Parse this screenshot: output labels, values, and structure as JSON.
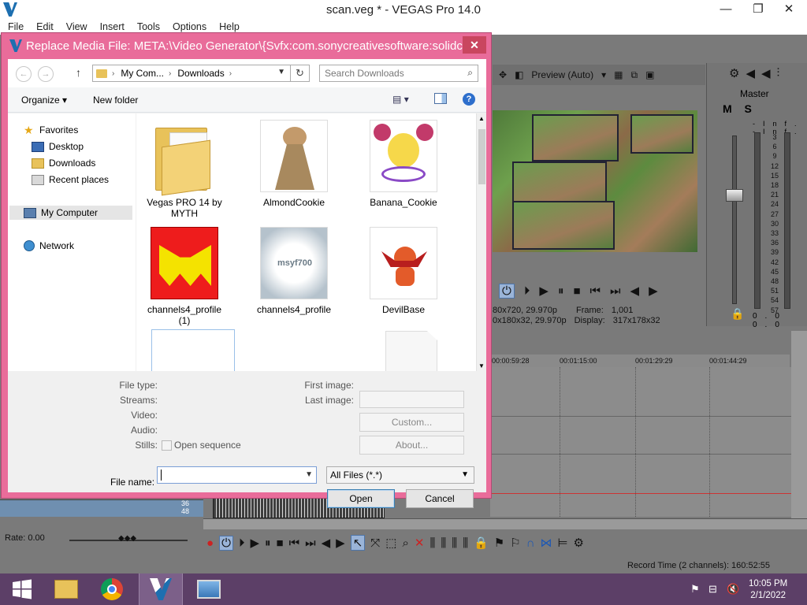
{
  "app": {
    "title": "scan.veg * - VEGAS Pro 14.0",
    "controls": {
      "minimize": "—",
      "restore": "❐",
      "close": "✕"
    },
    "menu": [
      "File",
      "Edit",
      "View",
      "Insert",
      "Tools",
      "Options",
      "Help"
    ]
  },
  "preview": {
    "mode": "Preview (Auto)",
    "info_left_1": "80x720, 29.970p",
    "info_left_2": "0x180x32, 29.970p",
    "frame_label": "Frame:",
    "frame_value": "1,001",
    "display_label": "Display:",
    "display_value": "317x178x32"
  },
  "master": {
    "label": "Master",
    "mute_solo": "M S",
    "inf_top": "-Inf. -Inf.",
    "scale": [
      "3",
      "6",
      "9",
      "12",
      "15",
      "18",
      "21",
      "24",
      "27",
      "30",
      "33",
      "36",
      "39",
      "42",
      "45",
      "48",
      "51",
      "54",
      "57"
    ],
    "foot": "0.0 0.0"
  },
  "timeline": {
    "ruler": [
      "00:00:59:28",
      "00:01:15:00",
      "00:01:29:29",
      "00:01:44:29"
    ],
    "track_nums": [
      "36",
      "48"
    ]
  },
  "bottom": {
    "rate": "Rate: 0.00",
    "record_time": "Record Time (2 channels): 160:52:55"
  },
  "dialog": {
    "title": "Replace Media File: META:\\Video Generator\\{Svfx:com.sonycreativesoftware:solidc...",
    "close": "✕",
    "breadcrumb": [
      "My Com...",
      "Downloads"
    ],
    "search_placeholder": "Search Downloads",
    "organize": "Organize",
    "new_folder": "New folder",
    "nav": {
      "favorites": "Favorites",
      "desktop": "Desktop",
      "downloads": "Downloads",
      "recent": "Recent places",
      "my_computer": "My Computer",
      "network": "Network"
    },
    "files": [
      {
        "name": "Vegas PRO 14 by MYTH"
      },
      {
        "name": "AlmondCookie"
      },
      {
        "name": "Banana_Cookie"
      },
      {
        "name": "channels4_profile (1)"
      },
      {
        "name": "channels4_profile"
      },
      {
        "name": "DevilBase"
      }
    ],
    "thumb_text": "msyf700",
    "details": {
      "file_type": "File type:",
      "streams": "Streams:",
      "video": "Video:",
      "audio": "Audio:",
      "stills": "Stills:",
      "open_sequence": "Open sequence",
      "first_image": "First image:",
      "last_image": "Last image:",
      "custom": "Custom...",
      "about": "About..."
    },
    "file_name_label": "File name:",
    "file_name_value": "",
    "file_type_value": "All Files (*.*)",
    "open": "Open",
    "cancel": "Cancel"
  },
  "taskbar": {
    "time": "10:05 PM",
    "date": "2/1/2022"
  },
  "colors": {
    "dialog_frame": "#e96c9a",
    "taskbar": "#5c3f67",
    "accent": "#2e6fcc"
  }
}
